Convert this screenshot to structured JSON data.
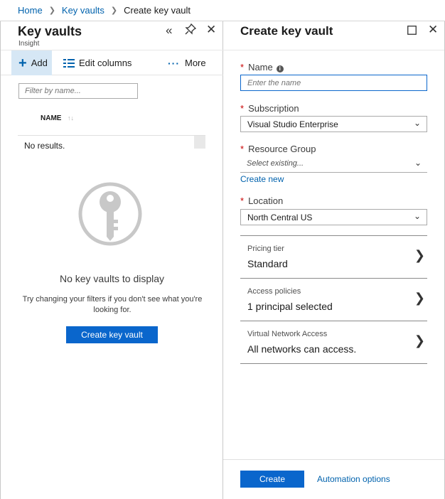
{
  "breadcrumb": {
    "home": "Home",
    "key_vaults": "Key vaults",
    "current": "Create key vault"
  },
  "left_blade": {
    "title": "Key vaults",
    "subtitle": "Insight",
    "icons": {
      "collapse": "«",
      "pin": "pin-icon",
      "close": "✕"
    },
    "toolbar": {
      "add": "Add",
      "edit_columns": "Edit columns",
      "more": "More"
    },
    "filter_placeholder": "Filter by name...",
    "column_name": "NAME",
    "no_results": "No results.",
    "empty_title": "No key vaults to display",
    "empty_text": "Try changing your filters if you don't see what you're looking for.",
    "create_button": "Create key vault"
  },
  "right_blade": {
    "title": "Create key vault",
    "required_mark": "*",
    "name": {
      "label": "Name",
      "placeholder": "Enter the name"
    },
    "subscription": {
      "label": "Subscription",
      "value": "Visual Studio Enterprise"
    },
    "resource_group": {
      "label": "Resource Group",
      "value": "Select existing...",
      "create_new": "Create new"
    },
    "location": {
      "label": "Location",
      "value": "North Central US"
    },
    "sections": [
      {
        "label": "Pricing tier",
        "value": "Standard"
      },
      {
        "label": "Access policies",
        "value": "1 principal selected"
      },
      {
        "label": "Virtual Network Access",
        "value": "All networks can access."
      }
    ],
    "footer": {
      "create": "Create",
      "automation": "Automation options"
    }
  },
  "colors": {
    "accent": "#0a66cc",
    "link": "#0062ad",
    "required": "#c80000"
  }
}
